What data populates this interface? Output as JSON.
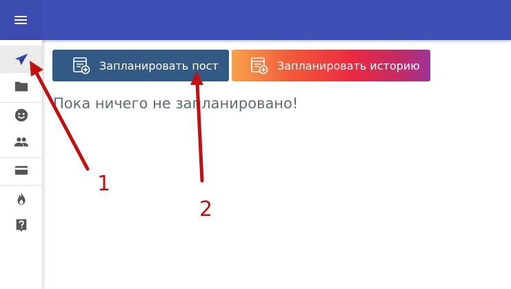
{
  "colors": {
    "topbar": "#3f4fb5",
    "accent": "#3f4fb5",
    "post_button": "#335a85",
    "story_gradient": [
      "#f7a24a",
      "#ec2a3f",
      "#9c3596"
    ],
    "annotation": "#c21010",
    "empty_text": "#5e6c7a"
  },
  "topbar": {
    "menu_icon": "hamburger-icon"
  },
  "sidebar": {
    "items": [
      {
        "id": "schedule",
        "icon": "paper-plane-icon",
        "active": true
      },
      {
        "id": "folders",
        "icon": "folder-icon",
        "active": false
      },
      {
        "id": "accounts",
        "icon": "smile-icon",
        "active": false
      },
      {
        "id": "team",
        "icon": "people-icon",
        "active": false
      },
      {
        "id": "billing",
        "icon": "credit-card-icon",
        "active": false
      },
      {
        "id": "hot",
        "icon": "flame-icon",
        "active": false
      },
      {
        "id": "help",
        "icon": "question-icon",
        "active": false
      }
    ]
  },
  "main": {
    "schedule_post_label": "Запланировать пост",
    "schedule_story_label": "Запланировать историю",
    "empty_message": "Пока ничего не запланировано!"
  },
  "annotations": {
    "arrow_1_label": "1",
    "arrow_2_label": "2"
  }
}
